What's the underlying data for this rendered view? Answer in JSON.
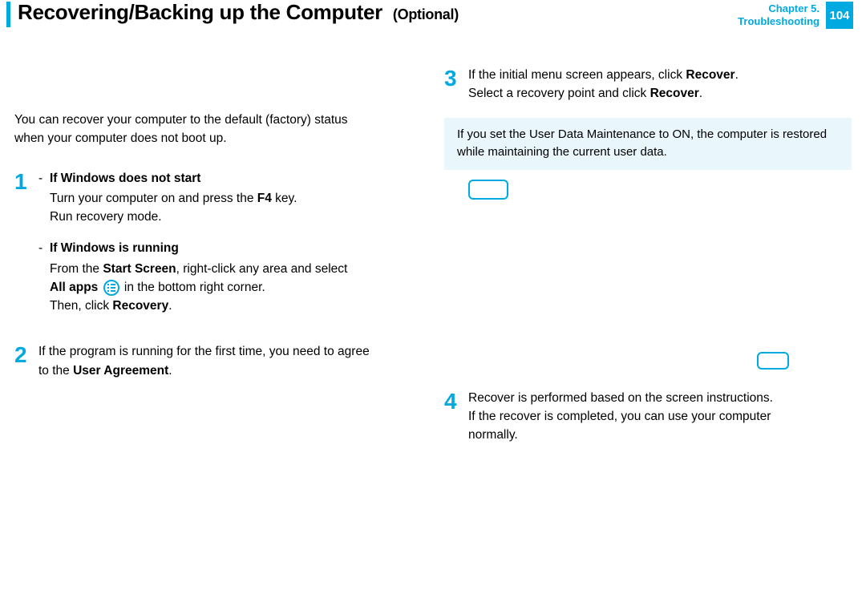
{
  "header": {
    "title_main": "Recovering/Backing up the Computer",
    "title_optional": "(Optional)",
    "chapter_label": "Chapter 5.",
    "chapter_sub": "Troubleshooting",
    "page_number": "104"
  },
  "left": {
    "lead_l1": "You can recover your computer to the default (factory) status",
    "lead_l2": "when your computer does not boot up.",
    "step1": {
      "num": "1",
      "a_title": "If Windows does not start",
      "a_l1_pre": "Turn your computer on and press the ",
      "a_l1_key": "F4",
      "a_l1_post": " key.",
      "a_l2": "Run recovery mode.",
      "b_title": "If Windows is running",
      "b_l1_pre": "From the ",
      "b_l1_bold": "Start Screen",
      "b_l1_post": ", right-click any area and select",
      "b_l2_bold": "All apps",
      "b_l2_post": " in the bottom right corner.",
      "b_l3_pre": "Then, click ",
      "b_l3_bold": "Recovery",
      "b_l3_post": "."
    },
    "step2": {
      "num": "2",
      "l1": "If the program is running for the first time, you need to agree",
      "l2_pre": "to the ",
      "l2_bold": "User Agreement",
      "l2_post": "."
    }
  },
  "right": {
    "step3": {
      "num": "3",
      "l1_pre": "If the initial menu screen appears, click ",
      "l1_bold": "Recover",
      "l1_post": ".",
      "l2_pre": "Select a recovery point and click ",
      "l2_bold": "Recover",
      "l2_post": "."
    },
    "note": "If you set the User Data Maintenance to ON, the computer is restored while maintaining the current user data.",
    "step4": {
      "num": "4",
      "l1": "Recover is performed based on the screen instructions.",
      "l2": "If the recover is completed, you can use your computer",
      "l3": "normally."
    }
  }
}
